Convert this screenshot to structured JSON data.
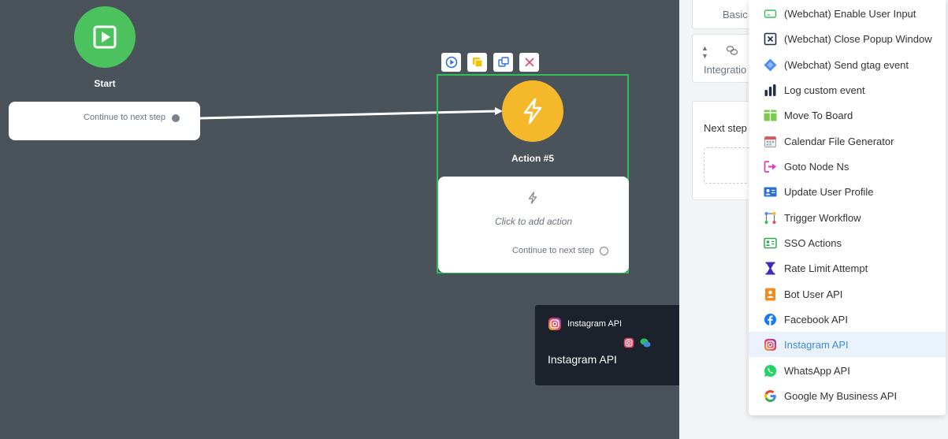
{
  "canvas": {
    "start_node": {
      "label": "Start",
      "continue_label": "Continue to next step"
    },
    "action_node": {
      "label": "Action #5",
      "placeholder": "Click to add action",
      "continue_label": "Continue to next step"
    }
  },
  "tooltip": {
    "header_label": "Instagram API",
    "title": "Instagram API"
  },
  "side_panel": {
    "basic_label": "Basic",
    "integration_label": "Integratio",
    "next_step_label": "Next step"
  },
  "menu": {
    "items": [
      {
        "label": "(Webchat) Enable User Input",
        "icon": "input-field-icon"
      },
      {
        "label": "(Webchat) Close Popup Window",
        "icon": "close-box-icon"
      },
      {
        "label": "(Webchat) Send gtag event",
        "icon": "gtag-diamond-icon"
      },
      {
        "label": "Log custom event",
        "icon": "bar-chart-icon"
      },
      {
        "label": "Move To Board",
        "icon": "board-icon"
      },
      {
        "label": "Calendar File Generator",
        "icon": "calendar-icon"
      },
      {
        "label": "Goto Node Ns",
        "icon": "goto-arrow-icon"
      },
      {
        "label": "Update User Profile",
        "icon": "profile-card-icon"
      },
      {
        "label": "Trigger Workflow",
        "icon": "workflow-icon"
      },
      {
        "label": "SSO Actions",
        "icon": "id-card-icon"
      },
      {
        "label": "Rate Limit Attempt",
        "icon": "hourglass-icon"
      },
      {
        "label": "Bot User API",
        "icon": "bot-user-icon"
      },
      {
        "label": "Facebook API",
        "icon": "facebook-icon"
      },
      {
        "label": "Instagram API",
        "icon": "instagram-icon"
      },
      {
        "label": "WhatsApp API",
        "icon": "whatsapp-icon"
      },
      {
        "label": "Google My Business API",
        "icon": "google-icon"
      }
    ],
    "active_item": "Instagram API"
  },
  "colors": {
    "canvas_bg": "#4a525a",
    "start_green": "#4bc25e",
    "action_yellow": "#f6b82b",
    "selection_green": "#2fbf58",
    "tooltip_bg": "#1c222b",
    "active_blue": "#3d8bd9"
  }
}
